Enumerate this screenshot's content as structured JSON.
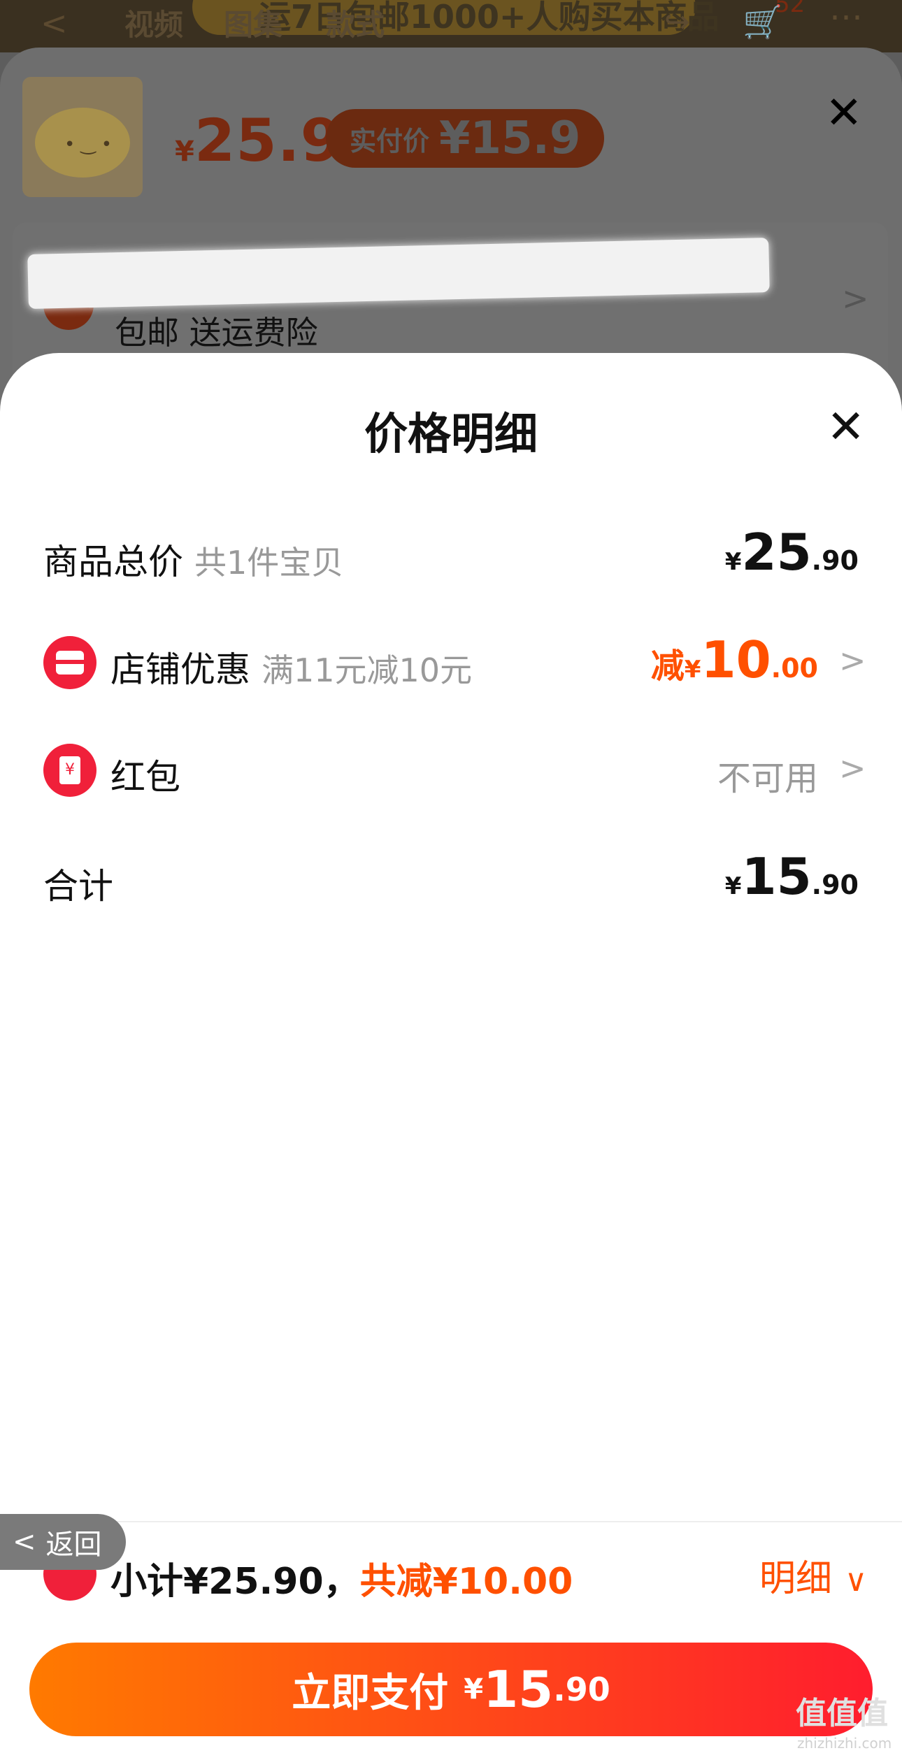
{
  "topbar": {
    "back_icon": "<",
    "tabs": [
      "视频",
      "图集",
      "款式"
    ],
    "promo_text": "运7日包邮1000+人购买本商品",
    "badge_count": "52"
  },
  "sku_panel": {
    "price_currency": "¥",
    "price": "25.9",
    "pay_label": "实付价",
    "pay_value": "¥15.9",
    "close_icon": "✕",
    "shipping_text": "包邮 送运费险"
  },
  "sheet": {
    "title": "价格明细",
    "close_icon": "✕",
    "rows": {
      "total": {
        "label": "商品总价",
        "sub": "共1件宝贝",
        "currency": "¥",
        "int": "25",
        "dec": ".90"
      },
      "shop_discount": {
        "label": "店铺优惠",
        "sub": "满11元减10元",
        "prefix": "减",
        "currency": "¥",
        "int": "10",
        "dec": ".00"
      },
      "red_packet": {
        "label": "红包",
        "value": "不可用"
      },
      "sum": {
        "label": "合计",
        "currency": "¥",
        "int": "15",
        "dec": ".90"
      }
    }
  },
  "footer": {
    "back_label": "返回",
    "subtotal_text": "小计¥25.90，",
    "reduce_text": "共减¥10.00",
    "detail_label": "明细",
    "pay_label": "立即支付",
    "pay_currency": "¥",
    "pay_int": "15",
    "pay_dec": ".90"
  },
  "watermark": {
    "main": "值值值",
    "sub": "zhizhizhi.com"
  },
  "colors": {
    "accent": "#ff5000",
    "red": "#f0203a",
    "gradient_start": "#ff7a00",
    "gradient_end": "#ff1d2e"
  }
}
